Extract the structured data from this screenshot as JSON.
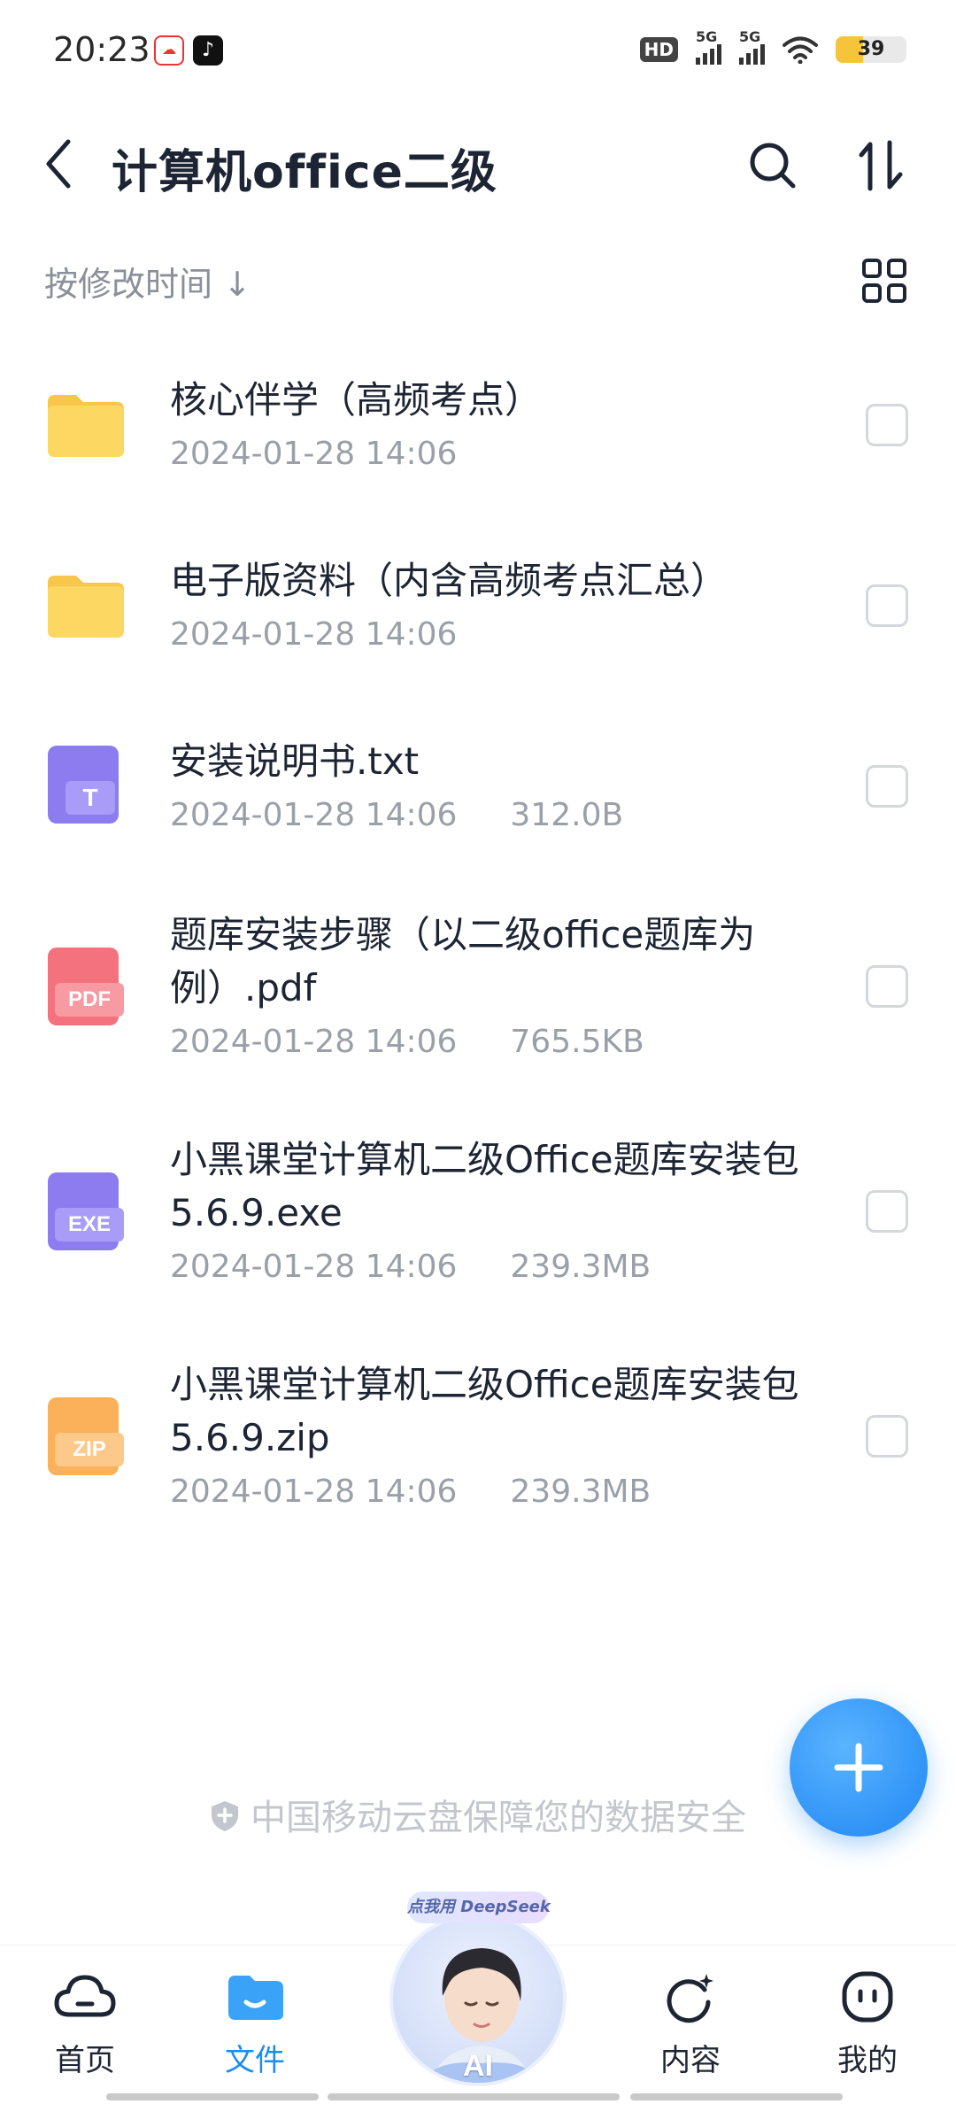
{
  "status_bar": {
    "time": "20:23",
    "hd_label": "HD",
    "signal1_label": "5G",
    "signal2_label": "5G",
    "battery_level": "39",
    "battery_color": "#f5c43b"
  },
  "header": {
    "title": "计算机office二级",
    "back_icon": "chevron-left-icon",
    "search_icon": "search-icon",
    "sort_icon": "sort-icon"
  },
  "sort_row": {
    "label": "按修改时间 ↓",
    "view_icon": "grid-view-icon"
  },
  "files": [
    {
      "name": "核心伴学（高频考点）",
      "date": "2024-01-28 14:06",
      "size": "",
      "type": "folder"
    },
    {
      "name": "电子版资料（内含高频考点汇总）",
      "date": "2024-01-28 14:06",
      "size": "",
      "type": "folder"
    },
    {
      "name": "安装说明书.txt",
      "date": "2024-01-28 14:06",
      "size": "312.0B",
      "type": "txt",
      "tag": "T"
    },
    {
      "name": "题库安装步骤（以二级office题库为例）.pdf",
      "date": "2024-01-28 14:06",
      "size": "765.5KB",
      "type": "pdf",
      "tag": "PDF"
    },
    {
      "name": "小黑课堂计算机二级Office题库安装包5.6.9.exe",
      "date": "2024-01-28 14:06",
      "size": "239.3MB",
      "type": "exe",
      "tag": "EXE"
    },
    {
      "name": "小黑课堂计算机二级Office题库安装包5.6.9.zip",
      "date": "2024-01-28 14:06",
      "size": "239.3MB",
      "type": "zip",
      "tag": "ZIP"
    }
  ],
  "security_note": "中国移动云盘保障您的数据安全",
  "fab_icon": "plus-icon",
  "bottom_nav": {
    "home": "首页",
    "files": "文件",
    "ai_badge": "点我用 DeepSeek",
    "ai_label": "AI",
    "content": "内容",
    "mine": "我的"
  },
  "colors": {
    "accent": "#1b8cf2",
    "folder": "#fcd45a",
    "txt": "#8c7cf0",
    "pdf": "#f4727e",
    "exe": "#8c7cf0",
    "zip": "#fbb05a"
  }
}
